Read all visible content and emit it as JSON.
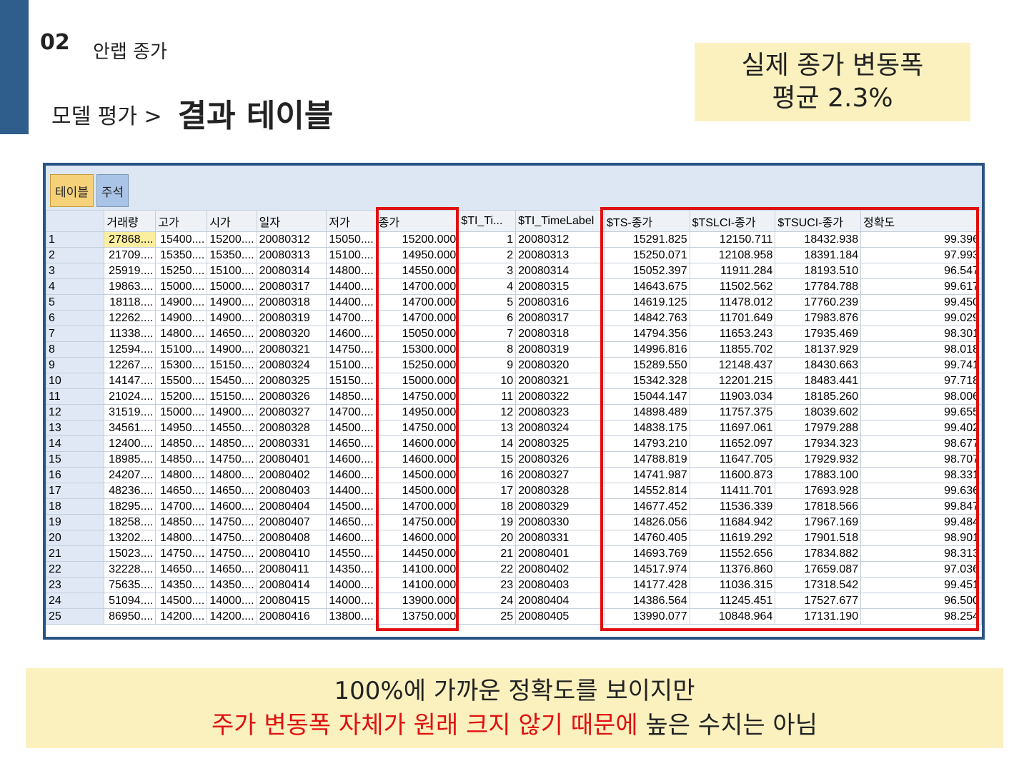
{
  "header": {
    "section_number": "02",
    "section_title": "안랩 종가",
    "breadcrumb": "모델 평가 >",
    "page_title": "결과 테이블"
  },
  "note": {
    "line1": "실제 종가 변동폭",
    "line2": "평균 2.3%"
  },
  "app": {
    "tabs": [
      {
        "label": "테이블",
        "active": true
      },
      {
        "label": "주석",
        "active": false
      }
    ],
    "columns": [
      "",
      "거래량",
      "고가",
      "시가",
      "일자",
      "저가",
      "종가",
      "$TI_Ti...",
      "$TI_TimeLabel",
      "$TS-종가",
      "$TSLCI-종가",
      "$TSUCI-종가",
      "정확도"
    ],
    "rows": [
      [
        "1",
        "27868....",
        "15400....",
        "15200....",
        "20080312",
        "15050....",
        "15200.000",
        "1",
        "20080312",
        "15291.825",
        "12150.711",
        "18432.938",
        "99.396"
      ],
      [
        "2",
        "21709....",
        "15350....",
        "15350....",
        "20080313",
        "15100....",
        "14950.000",
        "2",
        "20080313",
        "15250.071",
        "12108.958",
        "18391.184",
        "97.993"
      ],
      [
        "3",
        "25919....",
        "15250....",
        "15100....",
        "20080314",
        "14800....",
        "14550.000",
        "3",
        "20080314",
        "15052.397",
        "11911.284",
        "18193.510",
        "96.547"
      ],
      [
        "4",
        "19863....",
        "15000....",
        "15000....",
        "20080317",
        "14400....",
        "14700.000",
        "4",
        "20080315",
        "14643.675",
        "11502.562",
        "17784.788",
        "99.617"
      ],
      [
        "5",
        "18118....",
        "14900....",
        "14900....",
        "20080318",
        "14400....",
        "14700.000",
        "5",
        "20080316",
        "14619.125",
        "11478.012",
        "17760.239",
        "99.450"
      ],
      [
        "6",
        "12262....",
        "14900....",
        "14900....",
        "20080319",
        "14700....",
        "14700.000",
        "6",
        "20080317",
        "14842.763",
        "11701.649",
        "17983.876",
        "99.029"
      ],
      [
        "7",
        "11338....",
        "14800....",
        "14650....",
        "20080320",
        "14600....",
        "15050.000",
        "7",
        "20080318",
        "14794.356",
        "11653.243",
        "17935.469",
        "98.301"
      ],
      [
        "8",
        "12594....",
        "15100....",
        "14900....",
        "20080321",
        "14750....",
        "15300.000",
        "8",
        "20080319",
        "14996.816",
        "11855.702",
        "18137.929",
        "98.018"
      ],
      [
        "9",
        "12267....",
        "15300....",
        "15150....",
        "20080324",
        "15100....",
        "15250.000",
        "9",
        "20080320",
        "15289.550",
        "12148.437",
        "18430.663",
        "99.741"
      ],
      [
        "10",
        "14147....",
        "15500....",
        "15450....",
        "20080325",
        "15150....",
        "15000.000",
        "10",
        "20080321",
        "15342.328",
        "12201.215",
        "18483.441",
        "97.718"
      ],
      [
        "11",
        "21024....",
        "15200....",
        "15150....",
        "20080326",
        "14850....",
        "14750.000",
        "11",
        "20080322",
        "15044.147",
        "11903.034",
        "18185.260",
        "98.006"
      ],
      [
        "12",
        "31519....",
        "15000....",
        "14900....",
        "20080327",
        "14700....",
        "14950.000",
        "12",
        "20080323",
        "14898.489",
        "11757.375",
        "18039.602",
        "99.655"
      ],
      [
        "13",
        "34561....",
        "14950....",
        "14550....",
        "20080328",
        "14500....",
        "14750.000",
        "13",
        "20080324",
        "14838.175",
        "11697.061",
        "17979.288",
        "99.402"
      ],
      [
        "14",
        "12400....",
        "14850....",
        "14850....",
        "20080331",
        "14650....",
        "14600.000",
        "14",
        "20080325",
        "14793.210",
        "11652.097",
        "17934.323",
        "98.677"
      ],
      [
        "15",
        "18985....",
        "14850....",
        "14750....",
        "20080401",
        "14600....",
        "14600.000",
        "15",
        "20080326",
        "14788.819",
        "11647.705",
        "17929.932",
        "98.707"
      ],
      [
        "16",
        "24207....",
        "14800....",
        "14800....",
        "20080402",
        "14600....",
        "14500.000",
        "16",
        "20080327",
        "14741.987",
        "11600.873",
        "17883.100",
        "98.331"
      ],
      [
        "17",
        "48236....",
        "14650....",
        "14650....",
        "20080403",
        "14400....",
        "14500.000",
        "17",
        "20080328",
        "14552.814",
        "11411.701",
        "17693.928",
        "99.636"
      ],
      [
        "18",
        "18295....",
        "14700....",
        "14600....",
        "20080404",
        "14500....",
        "14700.000",
        "18",
        "20080329",
        "14677.452",
        "11536.339",
        "17818.566",
        "99.847"
      ],
      [
        "19",
        "18258....",
        "14850....",
        "14750....",
        "20080407",
        "14650....",
        "14750.000",
        "19",
        "20080330",
        "14826.056",
        "11684.942",
        "17967.169",
        "99.484"
      ],
      [
        "20",
        "13202....",
        "14800....",
        "14750....",
        "20080408",
        "14600....",
        "14600.000",
        "20",
        "20080331",
        "14760.405",
        "11619.292",
        "17901.518",
        "98.901"
      ],
      [
        "21",
        "15023....",
        "14750....",
        "14750....",
        "20080410",
        "14550....",
        "14450.000",
        "21",
        "20080401",
        "14693.769",
        "11552.656",
        "17834.882",
        "98.313"
      ],
      [
        "22",
        "32228....",
        "14650....",
        "14650....",
        "20080411",
        "14350....",
        "14100.000",
        "22",
        "20080402",
        "14517.974",
        "11376.860",
        "17659.087",
        "97.036"
      ],
      [
        "23",
        "75635....",
        "14350....",
        "14350....",
        "20080414",
        "14000....",
        "14100.000",
        "23",
        "20080403",
        "14177.428",
        "11036.315",
        "17318.542",
        "99.451"
      ],
      [
        "24",
        "51094....",
        "14500....",
        "14000....",
        "20080415",
        "14000....",
        "13900.000",
        "24",
        "20080404",
        "14386.564",
        "11245.451",
        "17527.677",
        "96.500"
      ],
      [
        "25",
        "86950....",
        "14200....",
        "14200....",
        "20080416",
        "13800....",
        "13750.000",
        "25",
        "20080405",
        "13990.077",
        "10848.964",
        "17131.190",
        "98.254"
      ]
    ],
    "highlight_color": "#e01010"
  },
  "footer": {
    "line1": "100%에 가까운 정확도를 보이지만",
    "line2_red": "주가 변동폭 자체가 원래 크지 않기 때문에",
    "line2_rest": " 높은 수치는 아님"
  }
}
